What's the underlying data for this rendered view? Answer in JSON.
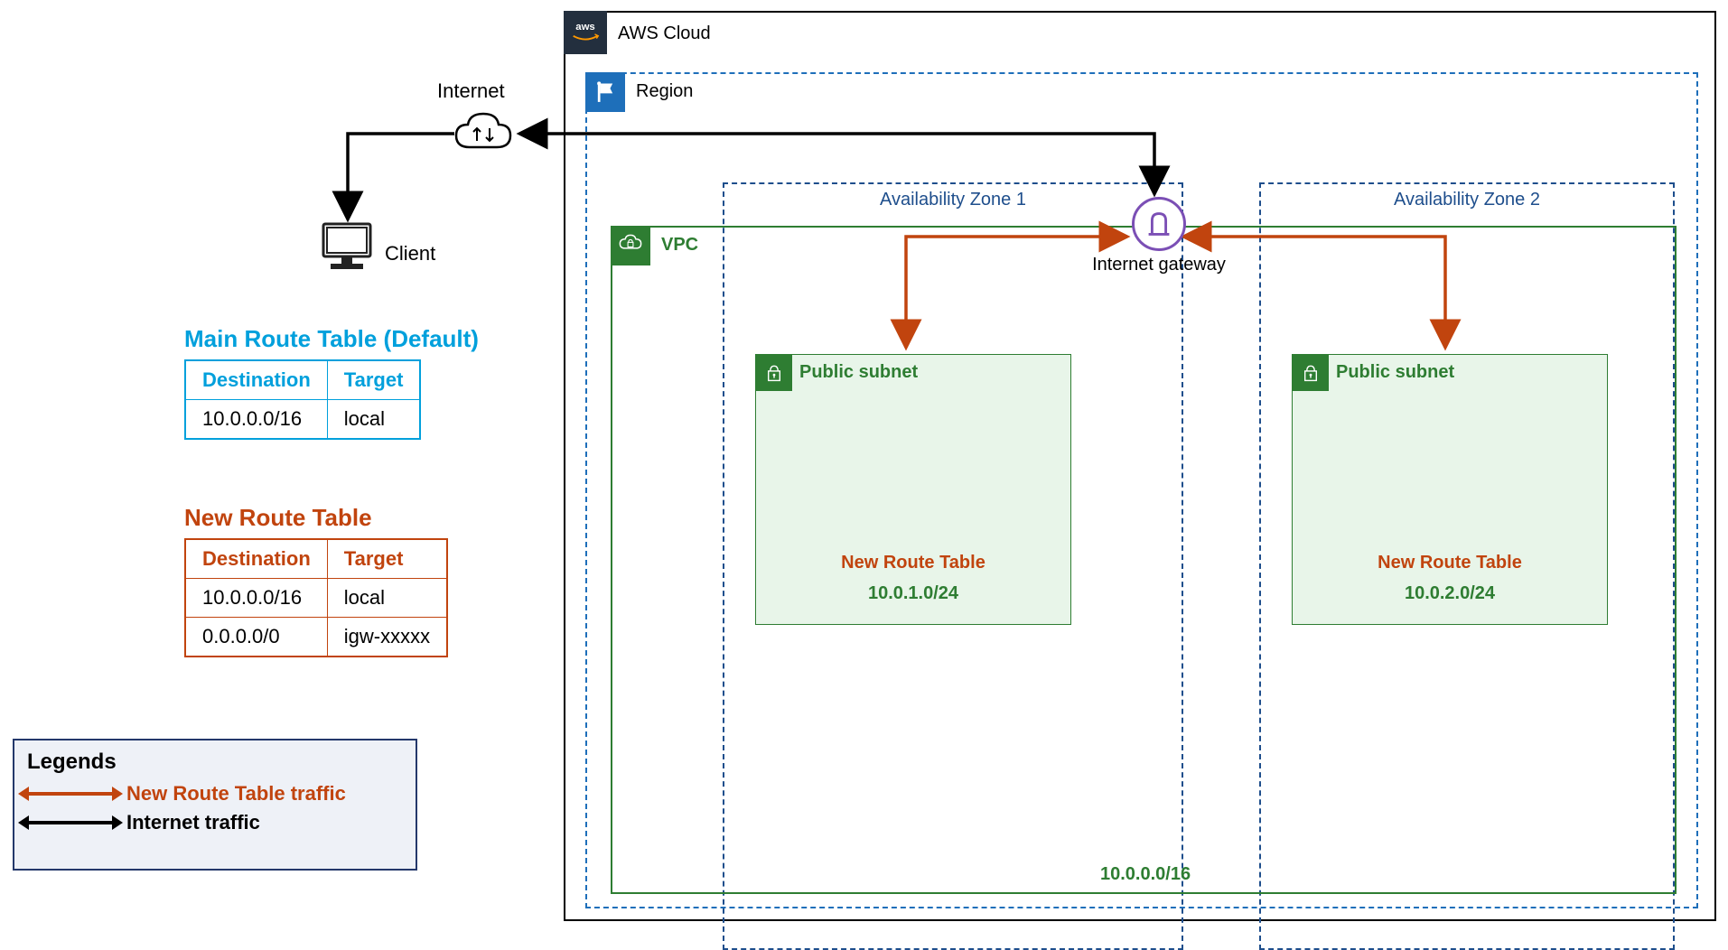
{
  "aws_cloud_label": "AWS Cloud",
  "region_label": "Region",
  "vpc": {
    "label": "VPC",
    "cidr": "10.0.0.0/16"
  },
  "az1_label": "Availability Zone 1",
  "az2_label": "Availability Zone 2",
  "igw_label": "Internet gateway",
  "subnet1": {
    "label": "Public subnet",
    "route": "New Route Table",
    "cidr": "10.0.1.0/24"
  },
  "subnet2": {
    "label": "Public subnet",
    "route": "New Route Table",
    "cidr": "10.0.2.0/24"
  },
  "internet_label": "Internet",
  "client_label": "Client",
  "main_route_table": {
    "title": "Main Route Table (Default)",
    "headers": {
      "dest": "Destination",
      "target": "Target"
    },
    "rows": [
      {
        "dest": "10.0.0.0/16",
        "target": "local"
      }
    ]
  },
  "new_route_table": {
    "title": "New Route Table",
    "headers": {
      "dest": "Destination",
      "target": "Target"
    },
    "rows": [
      {
        "dest": "10.0.0.0/16",
        "target": "local"
      },
      {
        "dest": "0.0.0.0/0",
        "target": "igw-xxxxx"
      }
    ]
  },
  "legends": {
    "title": "Legends",
    "new_route": "New Route Table traffic",
    "internet": "Internet traffic"
  }
}
